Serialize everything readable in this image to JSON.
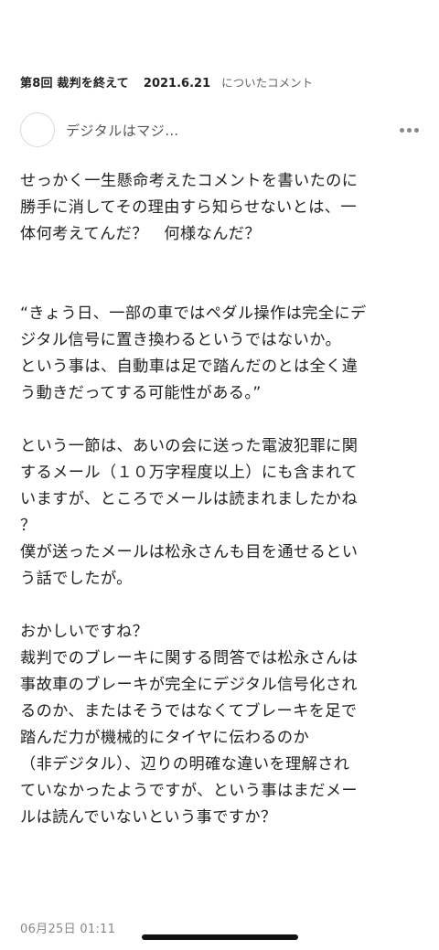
{
  "header": {
    "article_title": "第8回 裁判を終えて",
    "article_date": "2021.6.21",
    "suffix": "についたコメント"
  },
  "author": {
    "name": "デジタルはマジ…",
    "more_icon": "more-horizontal-icon"
  },
  "comment": {
    "paragraph1": "せっかく一生懸命考えたコメントを書いたのに\n勝手に消してその理由すら知らせないとは、一\n体何考えてんだ？　何様なんだ？",
    "paragraph2": "“きょう日、一部の車ではペダル操作は完全にデ\nジタル信号に置き換わるというではないか。\nという事は、自動車は足で踏んだのとは全く違\nう動きだってする可能性がある。”",
    "paragraph3": "という一節は、あいの会に送った電波犯罪に関\nするメール（１０万字程度以上）にも含まれて\nいますが、ところでメールは読まれましたかね\n？\n僕が送ったメールは松永さんも目を通せるとい\nう話でしたが。",
    "paragraph4": "おかしいですね？\n裁判でのブレーキに関する問答では松永さんは\n事故車のブレーキが完全にデジタル信号化され\nるのか、またはそうではなくてブレーキを足で\n踏んだ力が機械的にタイヤに伝わるのか\n（非デジタル）、辺りの明確な違いを理解され\nていなかったようですが、という事はまだメー\nルは読んでいないという事ですか？"
  },
  "timestamp": "06月25日 01:11"
}
